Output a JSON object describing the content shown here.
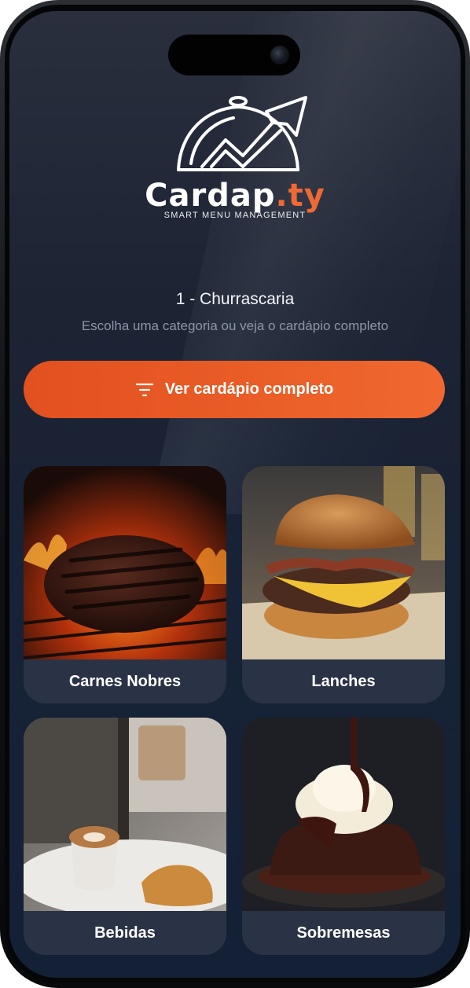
{
  "app": {
    "logo_main": "Cardap",
    "logo_accent": ".ty",
    "tagline": "SMART MENU MANAGEMENT"
  },
  "header": {
    "restaurant": "1 - Churrascaria",
    "subtitle": "Escolha uma categoria ou veja o cardápio completo"
  },
  "cta": {
    "label": "Ver cardápio completo",
    "icon": "filter-icon"
  },
  "categories": [
    {
      "label": "Carnes Nobres",
      "image": "grilled-steak-photo"
    },
    {
      "label": "Lanches",
      "image": "bacon-burger-photo"
    },
    {
      "label": "Bebidas",
      "image": "cappuccino-croissant-photo"
    },
    {
      "label": "Sobremesas",
      "image": "lava-cake-ice-cream-photo"
    }
  ],
  "colors": {
    "accent": "#ea5d27",
    "background": "#1c2333",
    "card": "#2a3345"
  }
}
